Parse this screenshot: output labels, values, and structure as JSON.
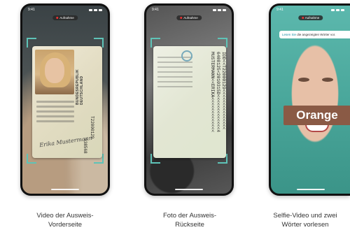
{
  "status": {
    "time": "9:41",
    "recording_label": "Aufnahme"
  },
  "phones": [
    {
      "id_card_front": {
        "country": "BUNDESREPUBLIK DEUTSCHLAND",
        "document_number": "T22000129",
        "signature": "Erika Mustermann",
        "can": "938568"
      },
      "caption_line1": "Video der Ausweis-",
      "caption_line2": "Vorderseite"
    },
    {
      "id_card_back": {
        "mrz_line1": "IDD<<T22000129<<<<<<<<<<<<<<<",
        "mrz_line2": "6408125<2010315D<<<<<<<<<<<<<4",
        "mrz_line3": "MUSTERMANN<<ERIKA<<<<<<<<<<<<<"
      },
      "caption_line1": "Foto der Ausweis-",
      "caption_line2": "Rückseite"
    },
    {
      "hint_accent": "Lesen Sie",
      "hint_rest": " die angezeigten Wörter vor.",
      "word": "Orange",
      "caption_line1": "Selfie-Video und zwei",
      "caption_line2": "Wörter vorlesen"
    }
  ],
  "colors": {
    "frame_accent": "#5ec3b7",
    "hint_accent": "#1a8fa6",
    "word_badge": "#8a5a45"
  }
}
